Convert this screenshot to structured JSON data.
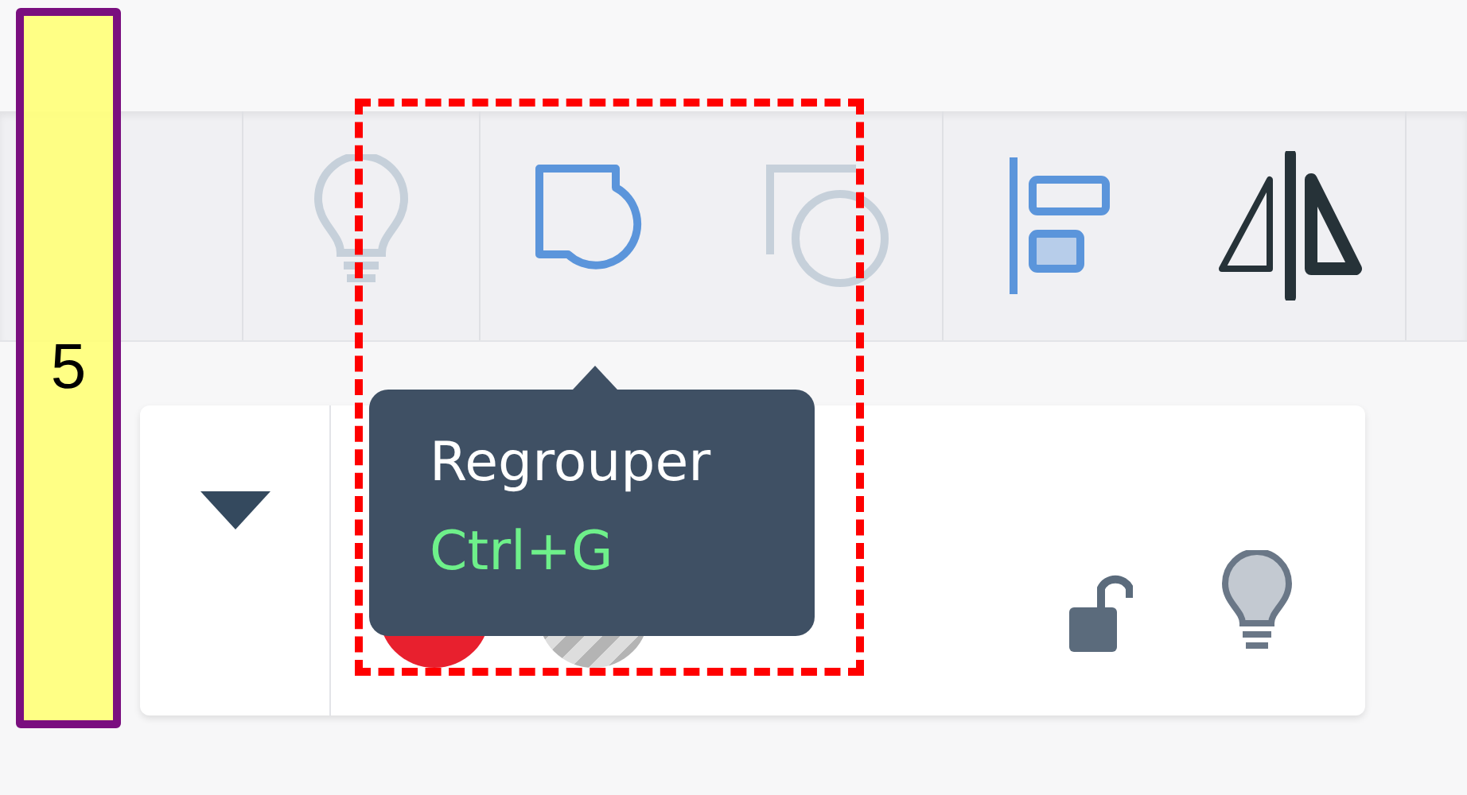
{
  "toolbar": {
    "groups": [
      {
        "tools": [
          {
            "kind": "bulb",
            "disabled": true
          }
        ]
      },
      {
        "tools": [
          {
            "kind": "group",
            "disabled": false
          },
          {
            "kind": "ungroup",
            "disabled": true
          }
        ]
      },
      {
        "tools": [
          {
            "kind": "align",
            "disabled": false
          },
          {
            "kind": "flip",
            "disabled": false
          }
        ]
      }
    ]
  },
  "tooltip": {
    "title": "Regrouper",
    "shortcut": "Ctrl+G"
  },
  "layer": {
    "expanded": true,
    "locked": false,
    "swatches": [
      {
        "kind": "solid",
        "color": "#e8202e"
      },
      {
        "kind": "striped",
        "color": "#b4b4b4"
      }
    ]
  },
  "annotation": {
    "label": "5"
  }
}
